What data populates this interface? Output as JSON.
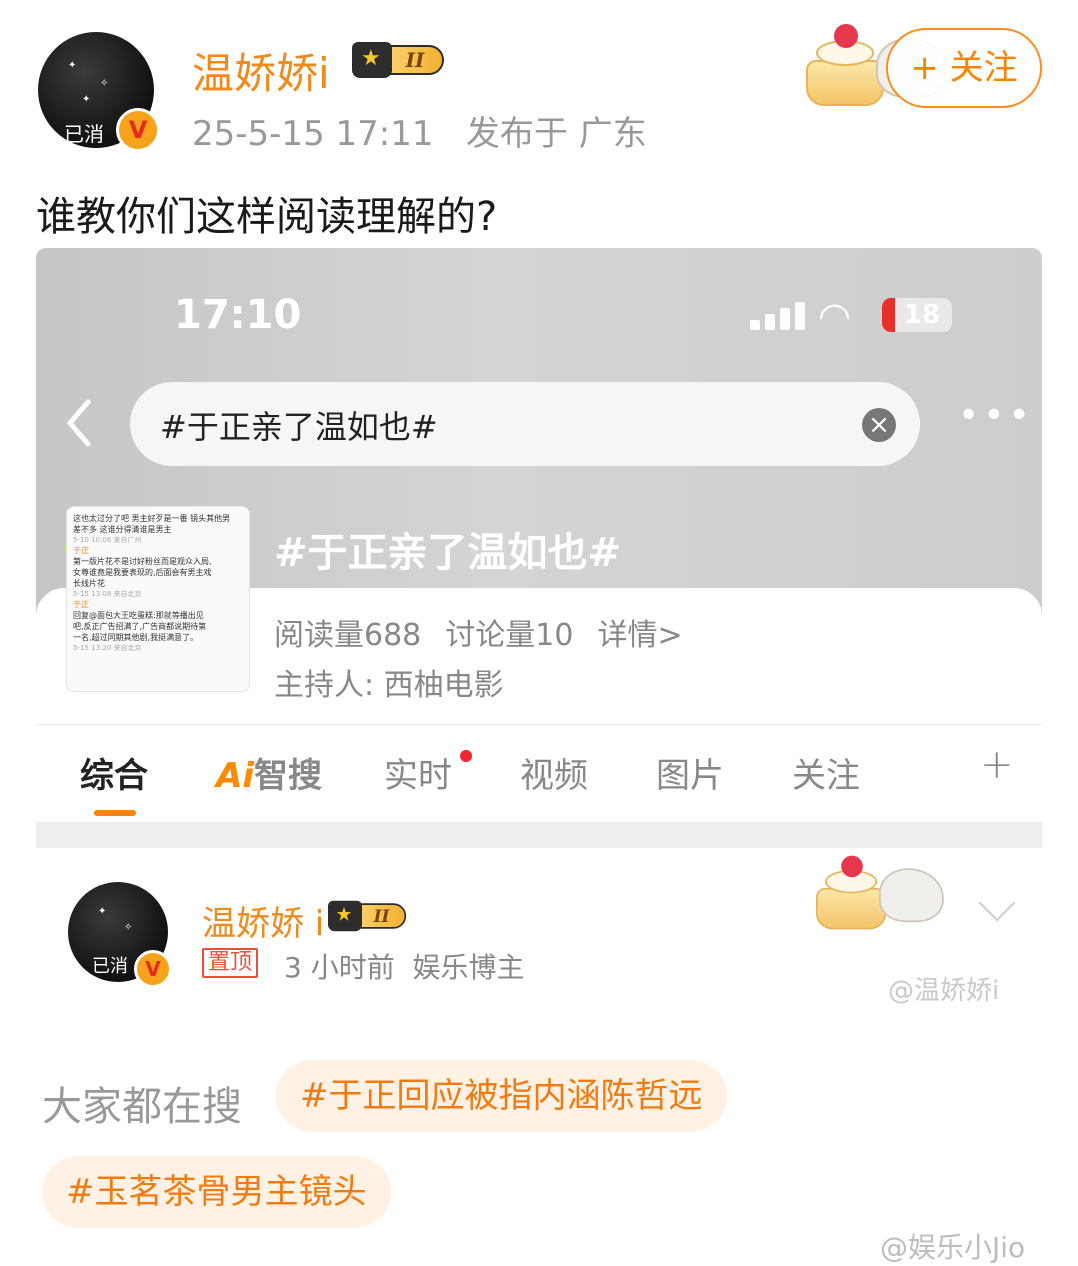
{
  "post": {
    "author_name": "温娇娇i",
    "avatar_caption": "已消",
    "verified_mark": "V",
    "crown_level": "II",
    "meta": "25-5-15 17:11   发布于 广东",
    "follow_label": "+ 关注",
    "text": "谁教你们这样阅读理解的?"
  },
  "screenshot": {
    "status": {
      "time": "17:10",
      "battery": "18",
      "battery_level": 0.18
    },
    "search": {
      "query": "#于正亲了温如也#"
    },
    "topic": {
      "title": "#于正亲了温如也#",
      "reads": "阅读量688",
      "discussions": "讨论量10",
      "details": "详情>",
      "host": "主持人: 西柚电影"
    },
    "thumb": {
      "lines": [
        "这也太过分了吧 男主好歹是一番 镜头其他男",
        "差不多 这谁分得清谁是男主"
      ],
      "meta1": "5-10 10:06 来自广州",
      "reply1_name": "于正",
      "reply1_lines": [
        "第一版片花不是讨好粉丝而是观众入局,",
        "女尊谁竟是我要表现的,后面会有男主戏",
        "长线片花"
      ],
      "meta2": "5-15 13:08 来自北京",
      "reply2_name": "于正",
      "reply2_lines": [
        "回复@面包大王吃蛋糕:那就等播出见",
        "吧,反正广告招满了,广告商都说期待第",
        "一名,超过同期其他剧,我挺满意了。"
      ],
      "meta3": "5-15 13:20 来自北京"
    },
    "tabs": [
      "综合",
      "智搜",
      "实时",
      "视频",
      "图片",
      "关注"
    ],
    "ai_prefix": "Ai",
    "active_tab": "综合",
    "plus": "+",
    "repost": {
      "name": "温娇娇 i",
      "avatar_caption": "已消",
      "pin": "置顶",
      "meta": "3 小时前  娱乐博主",
      "watermark": "@温娇娇i"
    },
    "hot_label": "大家都在搜",
    "hot_tags": [
      "#于正回应被指内涵陈哲远",
      "#玉茗茶骨男主镜头"
    ]
  },
  "footer_watermark": "@娱乐小Jio",
  "colors": {
    "accent": "#ff8200",
    "name": "#f08a1c",
    "chip_bg": "#fff1e3"
  }
}
